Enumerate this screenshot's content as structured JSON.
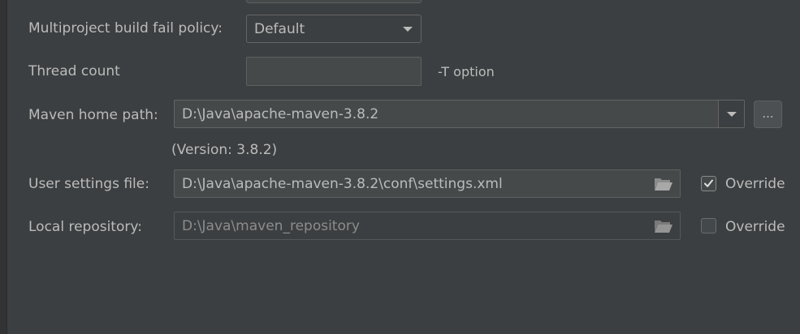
{
  "multiproject": {
    "label": "Multiproject build fail policy:",
    "selected": "Default"
  },
  "thread_count": {
    "label": "Thread count",
    "value": "",
    "hint": "-T option"
  },
  "maven_home": {
    "label": "Maven home path:",
    "value": "D:\\Java\\apache-maven-3.8.2",
    "browse_label": "...",
    "version": "(Version: 3.8.2)"
  },
  "user_settings": {
    "label": "User settings file:",
    "value": "D:\\Java\\apache-maven-3.8.2\\conf\\settings.xml",
    "override_label": "Override",
    "override_checked": true
  },
  "local_repo": {
    "label": "Local repository:",
    "value": "D:\\Java\\maven_repository",
    "override_label": "Override",
    "override_checked": false
  },
  "icons": {
    "combo_arrow": "chevron-down-icon",
    "browse_folder": "folder-icon",
    "checkmark": "checkmark-icon"
  },
  "colors": {
    "background": "#3c3f41",
    "text": "#bbbbbb",
    "disabled_text": "#8c8c8c",
    "border": "#646464"
  }
}
